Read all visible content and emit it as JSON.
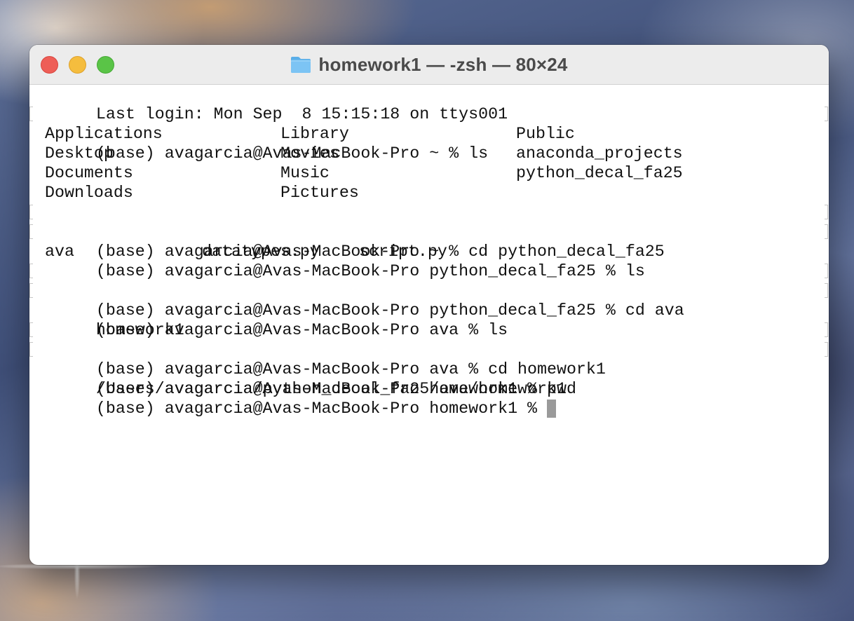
{
  "window": {
    "title": "homework1 — -zsh — 80×24",
    "title_icon": "folder-icon",
    "traffic_lights": {
      "close_color": "#ee5e57",
      "minimize_color": "#f5bd3e",
      "maximize_color": "#5ac447"
    }
  },
  "terminal": {
    "background": "#ffffff",
    "text_color": "#111111",
    "lines": {
      "login": "Last login: Mon Sep  8 15:15:18 on ttys001",
      "prompt_ls_home": "(base) avagarcia@Avas-MacBook-Pro ~ % ls",
      "ls_home": [
        [
          "Applications",
          "Library",
          "Public"
        ],
        [
          "Desktop",
          "Movies",
          "anaconda_projects"
        ],
        [
          "Documents",
          "Music",
          "python_decal_fa25"
        ],
        [
          "Downloads",
          "Pictures",
          ""
        ]
      ],
      "prompt_cd_decal": "(base) avagarcia@Avas-MacBook-Pro ~ % cd python_decal_fa25",
      "prompt_ls_decal": "(base) avagarcia@Avas-MacBook-Pro python_decal_fa25 % ls",
      "ls_decal": [
        "ava",
        "datatypes.py",
        "script.py"
      ],
      "prompt_cd_ava": "(base) avagarcia@Avas-MacBook-Pro python_decal_fa25 % cd ava",
      "prompt_ls_ava": "(base) avagarcia@Avas-MacBook-Pro ava % ls",
      "ls_ava": "homework1",
      "prompt_cd_hw": "(base) avagarcia@Avas-MacBook-Pro ava % cd homework1",
      "prompt_pwd": "(base) avagarcia@Avas-MacBook-Pro homework1 % pwd",
      "pwd_output": "/Users/avagarcia/python_decal_fa25/ava/homework1",
      "current_prompt": "(base) avagarcia@Avas-MacBook-Pro homework1 % "
    },
    "cursor_color": "#9a9a9a"
  }
}
